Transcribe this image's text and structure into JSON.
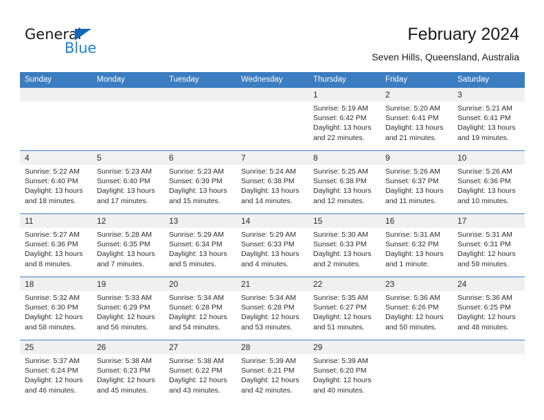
{
  "brand": {
    "name_part1": "General",
    "name_part2": "Blue",
    "accent_color": "#1a7fd4",
    "triangle_color": "#1268b3"
  },
  "header": {
    "title": "February 2024",
    "subtitle": "Seven Hills, Queensland, Australia"
  },
  "calendar": {
    "header_bg": "#3b7dc0",
    "daynum_bg": "#f0f0f0",
    "weekdays": [
      "Sunday",
      "Monday",
      "Tuesday",
      "Wednesday",
      "Thursday",
      "Friday",
      "Saturday"
    ],
    "weeks": [
      [
        {
          "day": "",
          "sunrise": "",
          "sunset": "",
          "daylight1": "",
          "daylight2": ""
        },
        {
          "day": "",
          "sunrise": "",
          "sunset": "",
          "daylight1": "",
          "daylight2": ""
        },
        {
          "day": "",
          "sunrise": "",
          "sunset": "",
          "daylight1": "",
          "daylight2": ""
        },
        {
          "day": "",
          "sunrise": "",
          "sunset": "",
          "daylight1": "",
          "daylight2": ""
        },
        {
          "day": "1",
          "sunrise": "Sunrise: 5:19 AM",
          "sunset": "Sunset: 6:42 PM",
          "daylight1": "Daylight: 13 hours",
          "daylight2": "and 22 minutes."
        },
        {
          "day": "2",
          "sunrise": "Sunrise: 5:20 AM",
          "sunset": "Sunset: 6:41 PM",
          "daylight1": "Daylight: 13 hours",
          "daylight2": "and 21 minutes."
        },
        {
          "day": "3",
          "sunrise": "Sunrise: 5:21 AM",
          "sunset": "Sunset: 6:41 PM",
          "daylight1": "Daylight: 13 hours",
          "daylight2": "and 19 minutes."
        }
      ],
      [
        {
          "day": "4",
          "sunrise": "Sunrise: 5:22 AM",
          "sunset": "Sunset: 6:40 PM",
          "daylight1": "Daylight: 13 hours",
          "daylight2": "and 18 minutes."
        },
        {
          "day": "5",
          "sunrise": "Sunrise: 5:23 AM",
          "sunset": "Sunset: 6:40 PM",
          "daylight1": "Daylight: 13 hours",
          "daylight2": "and 17 minutes."
        },
        {
          "day": "6",
          "sunrise": "Sunrise: 5:23 AM",
          "sunset": "Sunset: 6:39 PM",
          "daylight1": "Daylight: 13 hours",
          "daylight2": "and 15 minutes."
        },
        {
          "day": "7",
          "sunrise": "Sunrise: 5:24 AM",
          "sunset": "Sunset: 6:38 PM",
          "daylight1": "Daylight: 13 hours",
          "daylight2": "and 14 minutes."
        },
        {
          "day": "8",
          "sunrise": "Sunrise: 5:25 AM",
          "sunset": "Sunset: 6:38 PM",
          "daylight1": "Daylight: 13 hours",
          "daylight2": "and 12 minutes."
        },
        {
          "day": "9",
          "sunrise": "Sunrise: 5:26 AM",
          "sunset": "Sunset: 6:37 PM",
          "daylight1": "Daylight: 13 hours",
          "daylight2": "and 11 minutes."
        },
        {
          "day": "10",
          "sunrise": "Sunrise: 5:26 AM",
          "sunset": "Sunset: 6:36 PM",
          "daylight1": "Daylight: 13 hours",
          "daylight2": "and 10 minutes."
        }
      ],
      [
        {
          "day": "11",
          "sunrise": "Sunrise: 5:27 AM",
          "sunset": "Sunset: 6:36 PM",
          "daylight1": "Daylight: 13 hours",
          "daylight2": "and 8 minutes."
        },
        {
          "day": "12",
          "sunrise": "Sunrise: 5:28 AM",
          "sunset": "Sunset: 6:35 PM",
          "daylight1": "Daylight: 13 hours",
          "daylight2": "and 7 minutes."
        },
        {
          "day": "13",
          "sunrise": "Sunrise: 5:29 AM",
          "sunset": "Sunset: 6:34 PM",
          "daylight1": "Daylight: 13 hours",
          "daylight2": "and 5 minutes."
        },
        {
          "day": "14",
          "sunrise": "Sunrise: 5:29 AM",
          "sunset": "Sunset: 6:33 PM",
          "daylight1": "Daylight: 13 hours",
          "daylight2": "and 4 minutes."
        },
        {
          "day": "15",
          "sunrise": "Sunrise: 5:30 AM",
          "sunset": "Sunset: 6:33 PM",
          "daylight1": "Daylight: 13 hours",
          "daylight2": "and 2 minutes."
        },
        {
          "day": "16",
          "sunrise": "Sunrise: 5:31 AM",
          "sunset": "Sunset: 6:32 PM",
          "daylight1": "Daylight: 13 hours",
          "daylight2": "and 1 minute."
        },
        {
          "day": "17",
          "sunrise": "Sunrise: 5:31 AM",
          "sunset": "Sunset: 6:31 PM",
          "daylight1": "Daylight: 12 hours",
          "daylight2": "and 59 minutes."
        }
      ],
      [
        {
          "day": "18",
          "sunrise": "Sunrise: 5:32 AM",
          "sunset": "Sunset: 6:30 PM",
          "daylight1": "Daylight: 12 hours",
          "daylight2": "and 58 minutes."
        },
        {
          "day": "19",
          "sunrise": "Sunrise: 5:33 AM",
          "sunset": "Sunset: 6:29 PM",
          "daylight1": "Daylight: 12 hours",
          "daylight2": "and 56 minutes."
        },
        {
          "day": "20",
          "sunrise": "Sunrise: 5:34 AM",
          "sunset": "Sunset: 6:28 PM",
          "daylight1": "Daylight: 12 hours",
          "daylight2": "and 54 minutes."
        },
        {
          "day": "21",
          "sunrise": "Sunrise: 5:34 AM",
          "sunset": "Sunset: 6:28 PM",
          "daylight1": "Daylight: 12 hours",
          "daylight2": "and 53 minutes."
        },
        {
          "day": "22",
          "sunrise": "Sunrise: 5:35 AM",
          "sunset": "Sunset: 6:27 PM",
          "daylight1": "Daylight: 12 hours",
          "daylight2": "and 51 minutes."
        },
        {
          "day": "23",
          "sunrise": "Sunrise: 5:36 AM",
          "sunset": "Sunset: 6:26 PM",
          "daylight1": "Daylight: 12 hours",
          "daylight2": "and 50 minutes."
        },
        {
          "day": "24",
          "sunrise": "Sunrise: 5:36 AM",
          "sunset": "Sunset: 6:25 PM",
          "daylight1": "Daylight: 12 hours",
          "daylight2": "and 48 minutes."
        }
      ],
      [
        {
          "day": "25",
          "sunrise": "Sunrise: 5:37 AM",
          "sunset": "Sunset: 6:24 PM",
          "daylight1": "Daylight: 12 hours",
          "daylight2": "and 46 minutes."
        },
        {
          "day": "26",
          "sunrise": "Sunrise: 5:38 AM",
          "sunset": "Sunset: 6:23 PM",
          "daylight1": "Daylight: 12 hours",
          "daylight2": "and 45 minutes."
        },
        {
          "day": "27",
          "sunrise": "Sunrise: 5:38 AM",
          "sunset": "Sunset: 6:22 PM",
          "daylight1": "Daylight: 12 hours",
          "daylight2": "and 43 minutes."
        },
        {
          "day": "28",
          "sunrise": "Sunrise: 5:39 AM",
          "sunset": "Sunset: 6:21 PM",
          "daylight1": "Daylight: 12 hours",
          "daylight2": "and 42 minutes."
        },
        {
          "day": "29",
          "sunrise": "Sunrise: 5:39 AM",
          "sunset": "Sunset: 6:20 PM",
          "daylight1": "Daylight: 12 hours",
          "daylight2": "and 40 minutes."
        },
        {
          "day": "",
          "sunrise": "",
          "sunset": "",
          "daylight1": "",
          "daylight2": ""
        },
        {
          "day": "",
          "sunrise": "",
          "sunset": "",
          "daylight1": "",
          "daylight2": ""
        }
      ]
    ]
  }
}
